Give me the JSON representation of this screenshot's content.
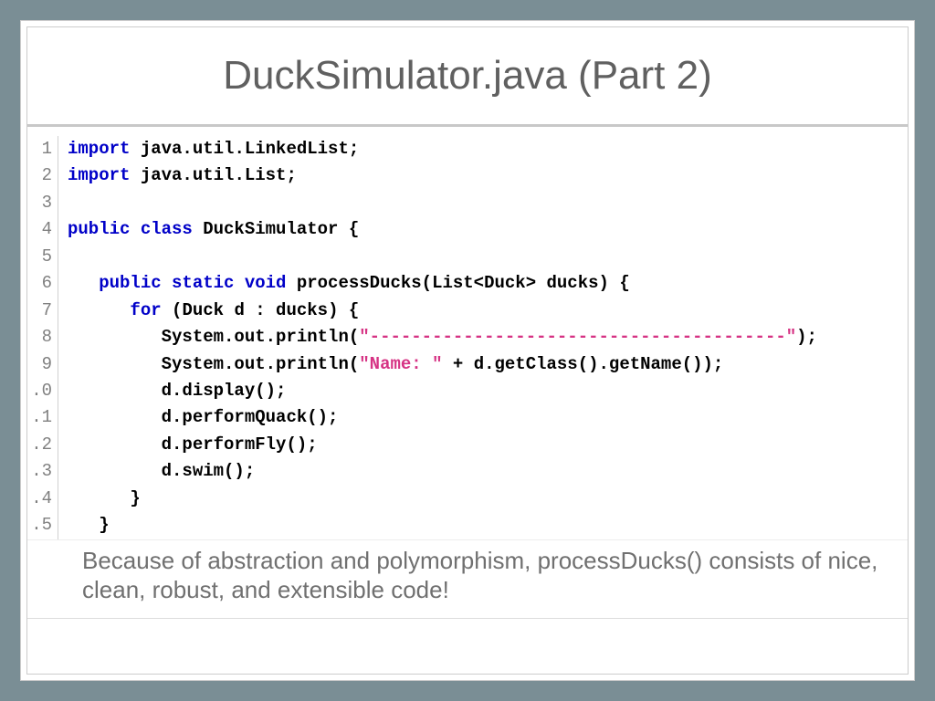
{
  "title": "DuckSimulator.java (Part 2)",
  "code": {
    "lines": [
      {
        "n": "1",
        "t": [
          {
            "c": "kw",
            "s": "import"
          },
          {
            "c": "",
            "s": " java.util.LinkedList;"
          }
        ]
      },
      {
        "n": "2",
        "t": [
          {
            "c": "kw",
            "s": "import"
          },
          {
            "c": "",
            "s": " java.util.List;"
          }
        ]
      },
      {
        "n": "3",
        "t": [
          {
            "c": "",
            "s": ""
          }
        ]
      },
      {
        "n": "4",
        "t": [
          {
            "c": "kw",
            "s": "public class"
          },
          {
            "c": "",
            "s": " DuckSimulator {"
          }
        ]
      },
      {
        "n": "5",
        "t": [
          {
            "c": "",
            "s": ""
          }
        ]
      },
      {
        "n": "6",
        "t": [
          {
            "c": "",
            "s": "   "
          },
          {
            "c": "kw",
            "s": "public static void"
          },
          {
            "c": "",
            "s": " processDucks(List<Duck> ducks) {"
          }
        ]
      },
      {
        "n": "7",
        "t": [
          {
            "c": "",
            "s": "      "
          },
          {
            "c": "kw",
            "s": "for"
          },
          {
            "c": "",
            "s": " (Duck d : ducks) {"
          }
        ]
      },
      {
        "n": "8",
        "t": [
          {
            "c": "",
            "s": "         System.out.println("
          },
          {
            "c": "str",
            "s": "\"----------------------------------------\""
          },
          {
            "c": "",
            "s": ");"
          }
        ]
      },
      {
        "n": "9",
        "t": [
          {
            "c": "",
            "s": "         System.out.println("
          },
          {
            "c": "str",
            "s": "\"Name: \""
          },
          {
            "c": "",
            "s": " + d.getClass().getName());"
          }
        ]
      },
      {
        "n": ".0",
        "t": [
          {
            "c": "",
            "s": "         d.display();"
          }
        ]
      },
      {
        "n": ".1",
        "t": [
          {
            "c": "",
            "s": "         d.performQuack();"
          }
        ]
      },
      {
        "n": ".2",
        "t": [
          {
            "c": "",
            "s": "         d.performFly();"
          }
        ]
      },
      {
        "n": ".3",
        "t": [
          {
            "c": "",
            "s": "         d.swim();"
          }
        ]
      },
      {
        "n": ".4",
        "t": [
          {
            "c": "",
            "s": "      }"
          }
        ]
      },
      {
        "n": ".5",
        "t": [
          {
            "c": "",
            "s": "   }"
          }
        ]
      }
    ]
  },
  "caption": "Because of abstraction and polymorphism, processDucks() consists of nice, clean, robust, and extensible code!"
}
